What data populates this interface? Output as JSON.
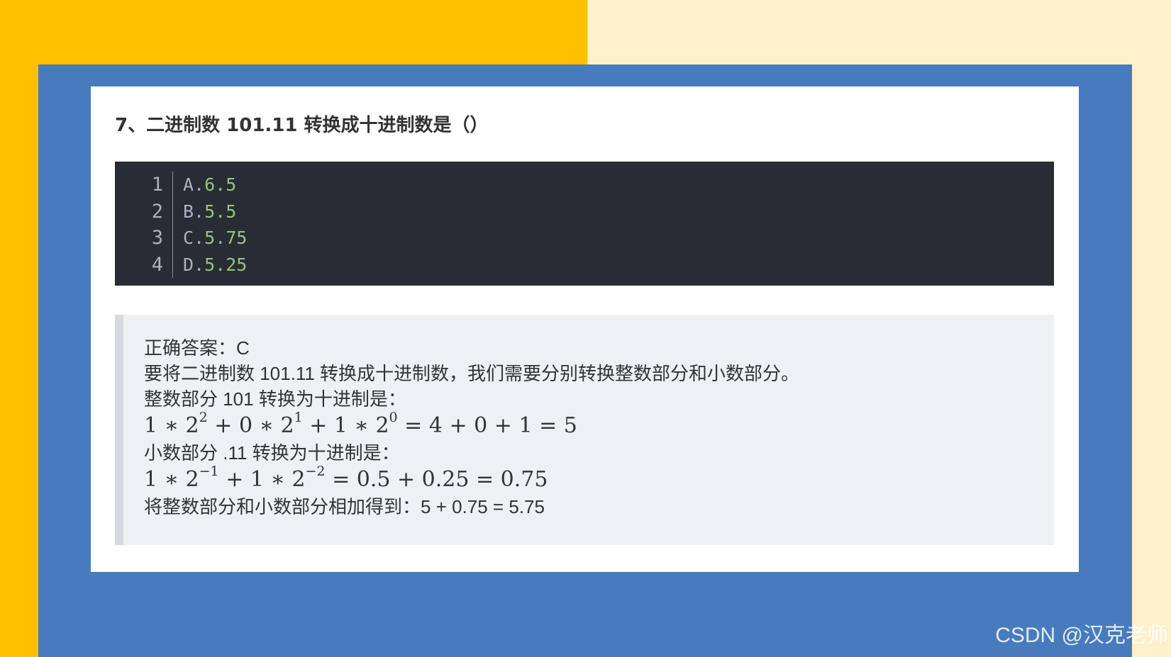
{
  "colors": {
    "background_left": "#FFC000",
    "background_right": "#FFF0CC",
    "frame": "#477BBD",
    "card": "#FFFFFF",
    "code_bg": "#282C34",
    "code_number": "#98C379",
    "answer_bg": "#EEF0F4"
  },
  "question": {
    "title": "7、二进制数 101.11 转换成十进制数是（）"
  },
  "code_block": {
    "lines": [
      {
        "num": "1",
        "letter": "A",
        "dot": ".",
        "value": "6.5"
      },
      {
        "num": "2",
        "letter": "B",
        "dot": ".",
        "value": "5.5"
      },
      {
        "num": "3",
        "letter": "C",
        "dot": ".",
        "value": "5.75"
      },
      {
        "num": "4",
        "letter": "D",
        "dot": ".",
        "value": "5.25"
      }
    ]
  },
  "answer": {
    "correct": "正确答案：C",
    "intro": "要将二进制数 101.11 转换成十进制数，我们需要分别转换整数部分和小数部分。",
    "integer_heading": "整数部分 101 转换为十进制是：",
    "integer_formula": {
      "t1_base": "1 ∗ 2",
      "t1_exp": "2",
      "t2_base": " + 0 ∗ 2",
      "t2_exp": "1",
      "t3_base": " + 1 ∗ 2",
      "t3_exp": "0",
      "rest": " = 4 + 0 + 1 = 5"
    },
    "fraction_heading": "小数部分 .11 转换为十进制是：",
    "fraction_formula": {
      "t1_base": "1 ∗ 2",
      "t1_exp": "−1",
      "t2_base": " + 1 ∗ 2",
      "t2_exp": "−2",
      "rest": " = 0.5 + 0.25 = 0.75"
    },
    "conclusion": "将整数部分和小数部分相加得到：5 + 0.75 = 5.75"
  },
  "watermark": "CSDN @汉克老师"
}
